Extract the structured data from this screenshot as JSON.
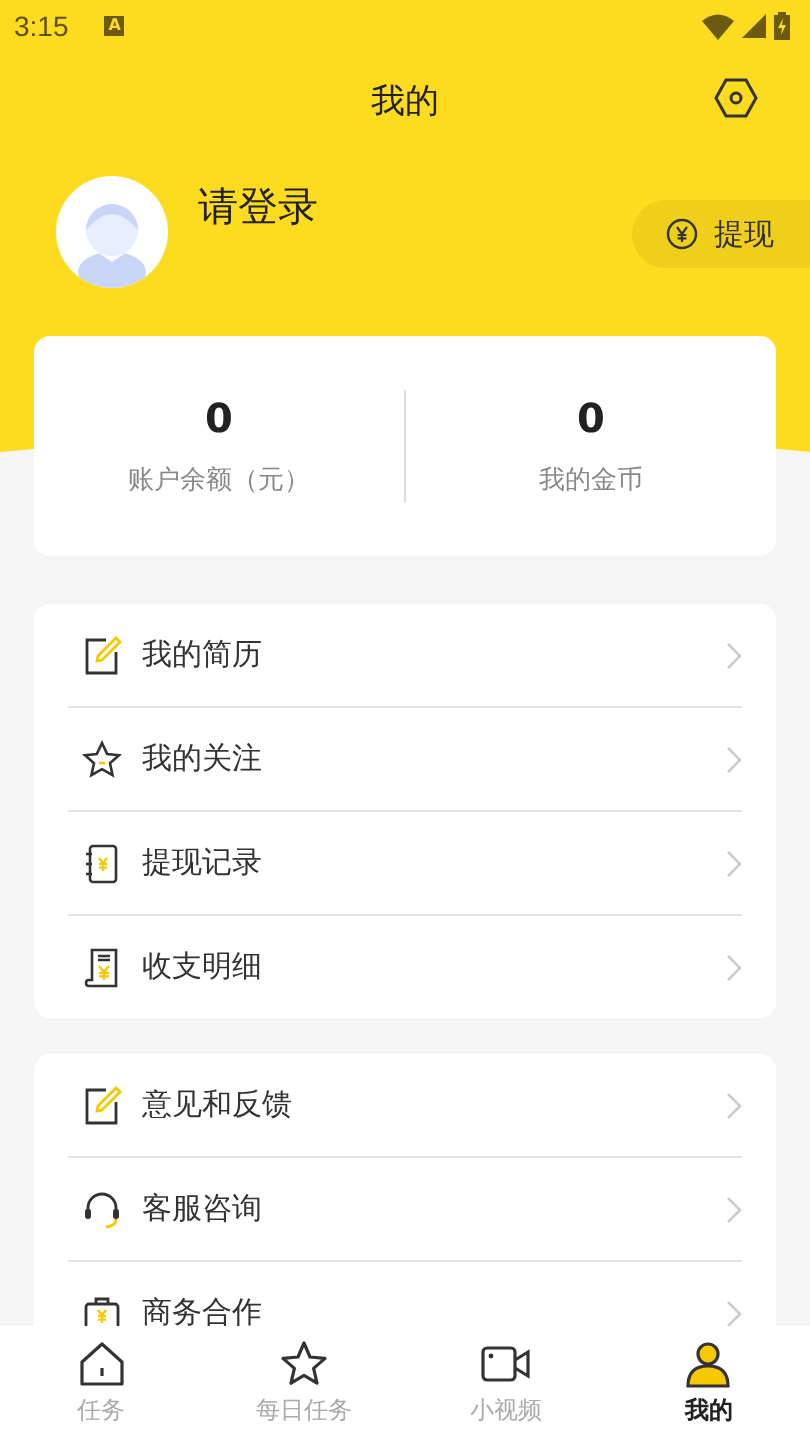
{
  "status_bar": {
    "time": "3:15",
    "notification": "A"
  },
  "header": {
    "title": "我的"
  },
  "profile": {
    "login_prompt": "请登录",
    "withdraw_button": "提现"
  },
  "stats": [
    {
      "value": "0",
      "label": "账户余额（元）"
    },
    {
      "value": "0",
      "label": "我的金币"
    }
  ],
  "menu_groups": [
    [
      {
        "label": "我的简历"
      },
      {
        "label": "我的关注"
      },
      {
        "label": "提现记录"
      },
      {
        "label": "收支明细"
      }
    ],
    [
      {
        "label": "意见和反馈"
      },
      {
        "label": "客服咨询"
      },
      {
        "label": "商务合作"
      }
    ]
  ],
  "tabs": [
    {
      "label": "任务",
      "selected": false
    },
    {
      "label": "每日任务",
      "selected": false
    },
    {
      "label": "小视频",
      "selected": false
    },
    {
      "label": "我的",
      "selected": true
    }
  ]
}
